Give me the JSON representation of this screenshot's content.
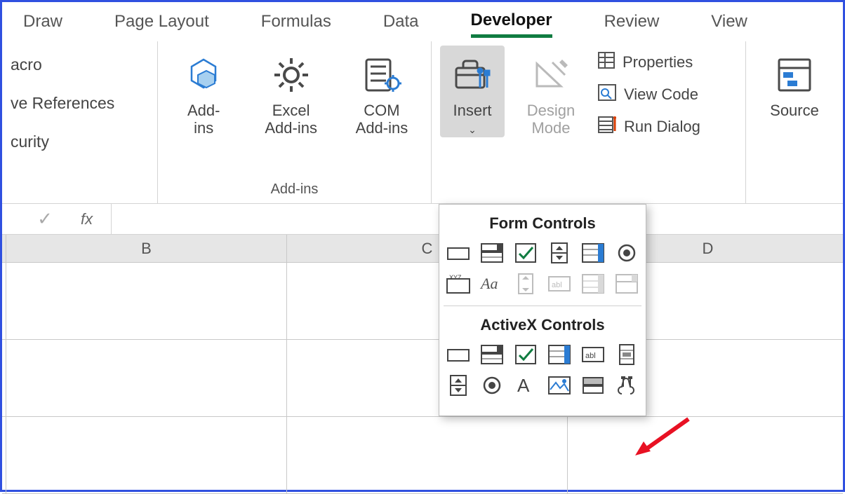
{
  "tabs": {
    "items": [
      {
        "label": "Draw",
        "active": false
      },
      {
        "label": "Page Layout",
        "active": false
      },
      {
        "label": "Formulas",
        "active": false
      },
      {
        "label": "Data",
        "active": false
      },
      {
        "label": "Developer",
        "active": true
      },
      {
        "label": "Review",
        "active": false
      },
      {
        "label": "View",
        "active": false
      }
    ]
  },
  "ribbon": {
    "code_group": {
      "item_macro": "acro",
      "item_relative": "ve References",
      "item_security": "curity"
    },
    "addins_group": {
      "label": "Add-ins",
      "addins": {
        "line1": "Add-",
        "line2": "ins"
      },
      "excel_addins": {
        "line1": "Excel",
        "line2": "Add-ins"
      },
      "com_addins": {
        "line1": "COM",
        "line2": "Add-ins"
      }
    },
    "controls_group": {
      "insert": "Insert",
      "design_mode": {
        "line1": "Design",
        "line2": "Mode"
      },
      "properties": "Properties",
      "view_code": "View Code",
      "run_dialog": "Run Dialog"
    },
    "xml_group": {
      "source": "Source"
    }
  },
  "formula_bar": {
    "fx_label": "fx",
    "value": ""
  },
  "columns": [
    "B",
    "C",
    "D"
  ],
  "dropdown": {
    "form_header": "Form Controls",
    "activex_header": "ActiveX Controls",
    "form_items": [
      {
        "name": "button-form",
        "disabled": false
      },
      {
        "name": "combobox-form",
        "disabled": false
      },
      {
        "name": "checkbox-form",
        "disabled": false
      },
      {
        "name": "spinner-form",
        "disabled": false
      },
      {
        "name": "listbox-form",
        "disabled": false
      },
      {
        "name": "option-form",
        "disabled": false
      },
      {
        "name": "groupbox-form",
        "disabled": false
      },
      {
        "name": "label-form",
        "disabled": false
      },
      {
        "name": "scrollbar-form",
        "disabled": true
      },
      {
        "name": "textfield-form",
        "disabled": true
      },
      {
        "name": "combo-list-form",
        "disabled": true
      },
      {
        "name": "dropdown-form",
        "disabled": true
      }
    ],
    "activex_items": [
      {
        "name": "command-button-ax",
        "disabled": false
      },
      {
        "name": "combobox-ax",
        "disabled": false
      },
      {
        "name": "checkbox-ax",
        "disabled": false
      },
      {
        "name": "listbox-ax",
        "disabled": false
      },
      {
        "name": "textbox-ax",
        "disabled": false
      },
      {
        "name": "scrollbar-ax",
        "disabled": false
      },
      {
        "name": "spin-button-ax",
        "disabled": false
      },
      {
        "name": "option-button-ax",
        "disabled": false
      },
      {
        "name": "label-ax",
        "disabled": false
      },
      {
        "name": "image-ax",
        "disabled": false
      },
      {
        "name": "toggle-button-ax",
        "disabled": false
      },
      {
        "name": "more-controls-ax",
        "disabled": false
      }
    ]
  }
}
